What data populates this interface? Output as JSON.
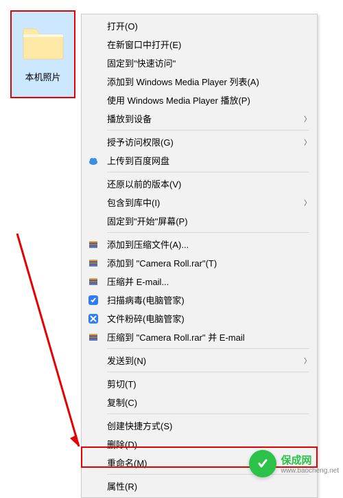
{
  "folder": {
    "label": "本机照片"
  },
  "menu": {
    "open": "打开(O)",
    "open_new_window": "在新窗口中打开(E)",
    "pin_quick_access": "固定到\"快速访问\"",
    "add_wmp_list": "添加到 Windows Media Player 列表(A)",
    "play_wmp": "使用 Windows Media Player 播放(P)",
    "cast_device": "播放到设备",
    "grant_access": "授予访问权限(G)",
    "upload_baidu": "上传到百度网盘",
    "restore_versions": "还原以前的版本(V)",
    "include_library": "包含到库中(I)",
    "pin_start": "固定到\"开始\"屏幕(P)",
    "add_archive": "添加到压缩文件(A)...",
    "add_camera_roll": "添加到 \"Camera Roll.rar\"(T)",
    "compress_email": "压缩并 E-mail...",
    "scan_virus": "扫描病毒(电脑管家)",
    "file_shred": "文件粉碎(电脑管家)",
    "compress_camera_email": "压缩到 \"Camera Roll.rar\" 并 E-mail",
    "send_to": "发送到(N)",
    "cut": "剪切(T)",
    "copy": "复制(C)",
    "create_shortcut": "创建快捷方式(S)",
    "delete": "删除(D)",
    "rename": "重命名(M)",
    "properties": "属性(R)"
  },
  "watermark": {
    "brand": "保成网",
    "domain": "www.baocheng.net"
  }
}
